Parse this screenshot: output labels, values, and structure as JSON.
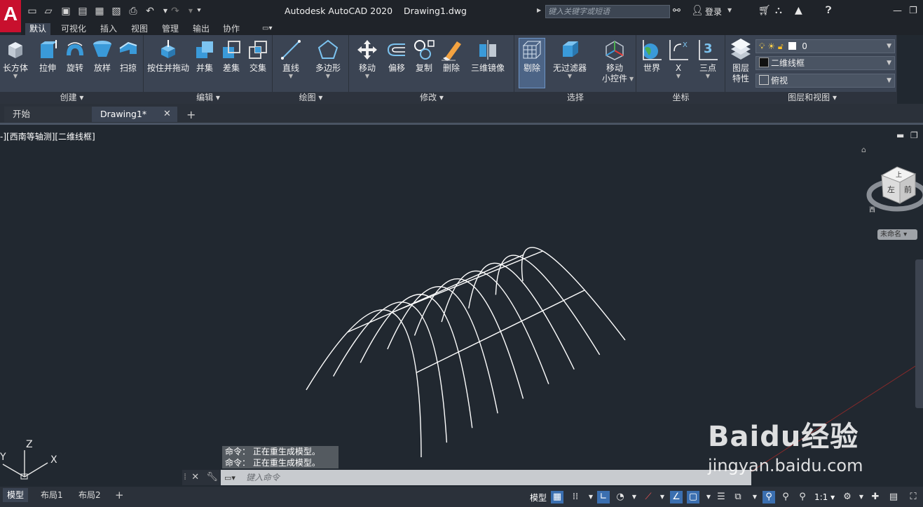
{
  "titlebar": {
    "app_title": "Autodesk AutoCAD 2020",
    "doc_title": "Drawing1.dwg",
    "search_placeholder": "键入关键字或短语",
    "login_label": "登录",
    "app_button": "A"
  },
  "ribbon_tabs": [
    "默认",
    "可视化",
    "插入",
    "视图",
    "管理",
    "输出",
    "协作"
  ],
  "active_tab": "默认",
  "panels": {
    "create": {
      "title": "创建",
      "tools": [
        "长方体",
        "拉伸",
        "旋转",
        "放样",
        "扫掠"
      ]
    },
    "edit": {
      "title": "编辑",
      "tools": [
        "按住并拖动",
        "并集",
        "差集",
        "交集"
      ]
    },
    "draw": {
      "title": "绘图",
      "tools": [
        "直线",
        "多边形"
      ]
    },
    "modify": {
      "title": "修改",
      "tools": [
        "移动",
        "偏移",
        "复制",
        "删除",
        "三维镜像"
      ]
    },
    "select": {
      "title": "选择",
      "tools": [
        "剔除",
        "无过滤器",
        "移动",
        "小控件"
      ]
    },
    "coords": {
      "title": "坐标",
      "tools": [
        "世界",
        "X",
        "三点"
      ]
    },
    "layers": {
      "title": "图层和视图",
      "tool_line1": "图层",
      "tool_line2": "特性",
      "layer_name": "0",
      "visual_style": "二维线框",
      "view": "俯视"
    }
  },
  "doc_tabs": [
    "开始",
    "Drawing1*"
  ],
  "viewport": {
    "label": "-][西南等轴测][二维线框]",
    "viewcube_top": "上",
    "viewcube_left": "左",
    "viewcube_front": "前",
    "viewcube_compass": "西",
    "ucs_name": "未命名",
    "ucs_x": "X",
    "ucs_y": "Y",
    "ucs_z": "Z"
  },
  "command": {
    "history": [
      "命令： 正在重生成模型。",
      "命令： 正在重生成模型。"
    ],
    "placeholder": "键入命令"
  },
  "layout_tabs": [
    "模型",
    "布局1",
    "布局2"
  ],
  "status": {
    "model_label": "模型",
    "scale": "1:1"
  },
  "watermark": {
    "brand": "Baidu经验",
    "url": "jingyan.baidu.com"
  },
  "colors": {
    "ribbon_bg": "#3b4453",
    "canvas_bg": "#212830",
    "accent": "#3b6fb0",
    "app_red": "#c8102e"
  }
}
